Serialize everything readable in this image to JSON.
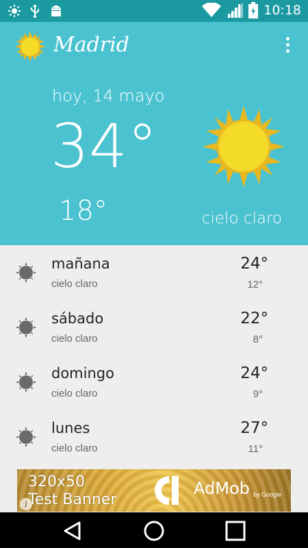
{
  "status_bar": {
    "time": "10:18",
    "left_icons": [
      "brightness-icon",
      "usb-icon",
      "android-icon"
    ],
    "right_icons": [
      "wifi-icon",
      "signal-icon",
      "battery-icon"
    ]
  },
  "app_bar": {
    "city": "Madrid",
    "logo_icon": "sun-icon",
    "menu_icon": "overflow-menu-icon"
  },
  "today": {
    "date": "hoy, 14 mayo",
    "high": "34°",
    "low": "18°",
    "condition": "cielo claro",
    "icon": "sun-icon"
  },
  "forecast": [
    {
      "day": "mañana",
      "condition": "cielo claro",
      "high": "24°",
      "low": "12°"
    },
    {
      "day": "sábado",
      "condition": "cielo claro",
      "high": "22°",
      "low": "8°"
    },
    {
      "day": "domingo",
      "condition": "cielo claro",
      "high": "24°",
      "low": "9°"
    },
    {
      "day": "lunes",
      "condition": "cielo claro",
      "high": "27°",
      "low": "11°"
    }
  ],
  "ad": {
    "size": "320x50",
    "label": "Test Banner",
    "brand": "AdMob",
    "by": "by Google",
    "info": "i"
  },
  "colors": {
    "hero": "#4ac2d0",
    "status_bar": "#1a9aa0",
    "list_bg": "#eeeeee",
    "sun_fill": "#f5dc28",
    "sun_rays": "#e8b820"
  }
}
